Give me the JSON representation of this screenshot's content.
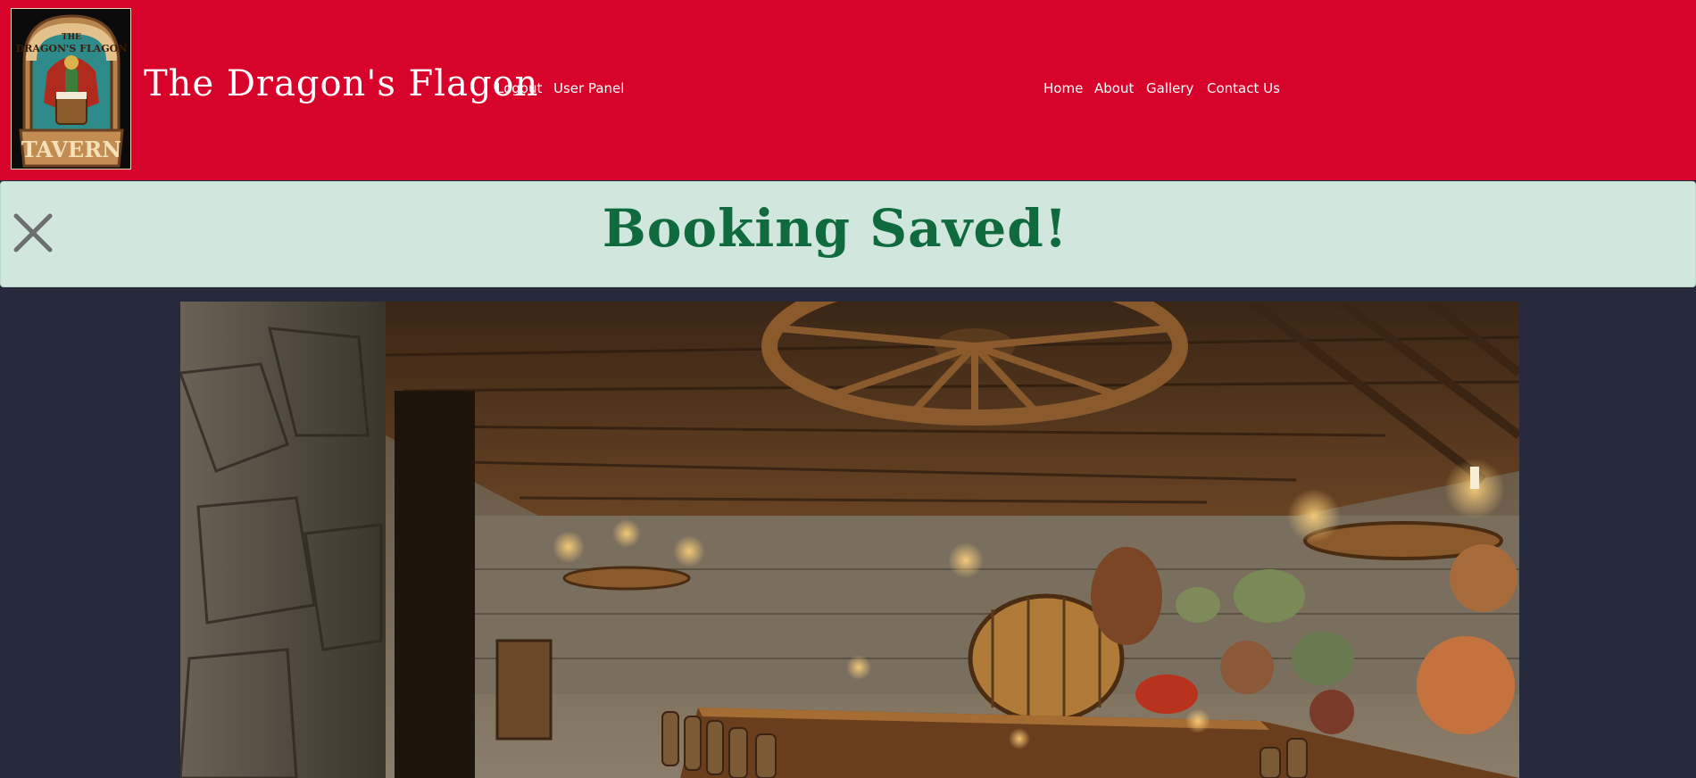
{
  "site": {
    "title": "The Dragon's Flagon",
    "logo_text_top": "THE DRAGON'S FLAGON",
    "logo_text_bottom": "TAVERN"
  },
  "nav_left": [
    {
      "label": "Logout"
    },
    {
      "label": "User Panel"
    }
  ],
  "nav_right": [
    {
      "label": "Home"
    },
    {
      "label": "About"
    },
    {
      "label": "Gallery"
    },
    {
      "label": "Contact Us"
    }
  ],
  "alert": {
    "message": "Booking Saved!",
    "close_icon": "close-x-icon"
  },
  "hero": {
    "image": "tavern-interior"
  },
  "colors": {
    "header_bg": "#d8032b",
    "page_bg": "#272a3d",
    "alert_bg": "#d1e7dd",
    "alert_text": "#0f6b3e"
  }
}
